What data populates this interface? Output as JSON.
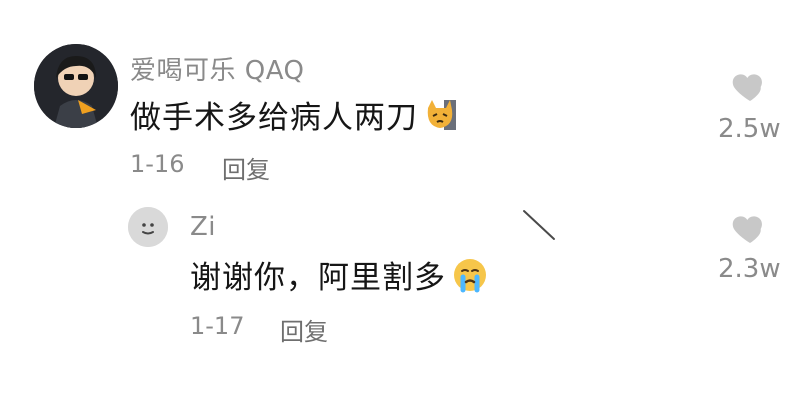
{
  "comments": [
    {
      "username": "爱喝可乐 QAQ",
      "text": "做手术多给病人两刀",
      "emoji": "cat-face-emoji",
      "date": "1-16",
      "reply_label": "回复",
      "likes": "2.5w"
    },
    {
      "username": "Zi",
      "text": "谢谢你，阿里割多",
      "emoji": "crying-face-emoji",
      "date": "1-17",
      "reply_label": "回复",
      "likes": "2.3w"
    }
  ],
  "colors": {
    "text": "#161616",
    "muted": "#8a8a8a",
    "heart": "#c8c8c8",
    "background": "#ffffff"
  }
}
